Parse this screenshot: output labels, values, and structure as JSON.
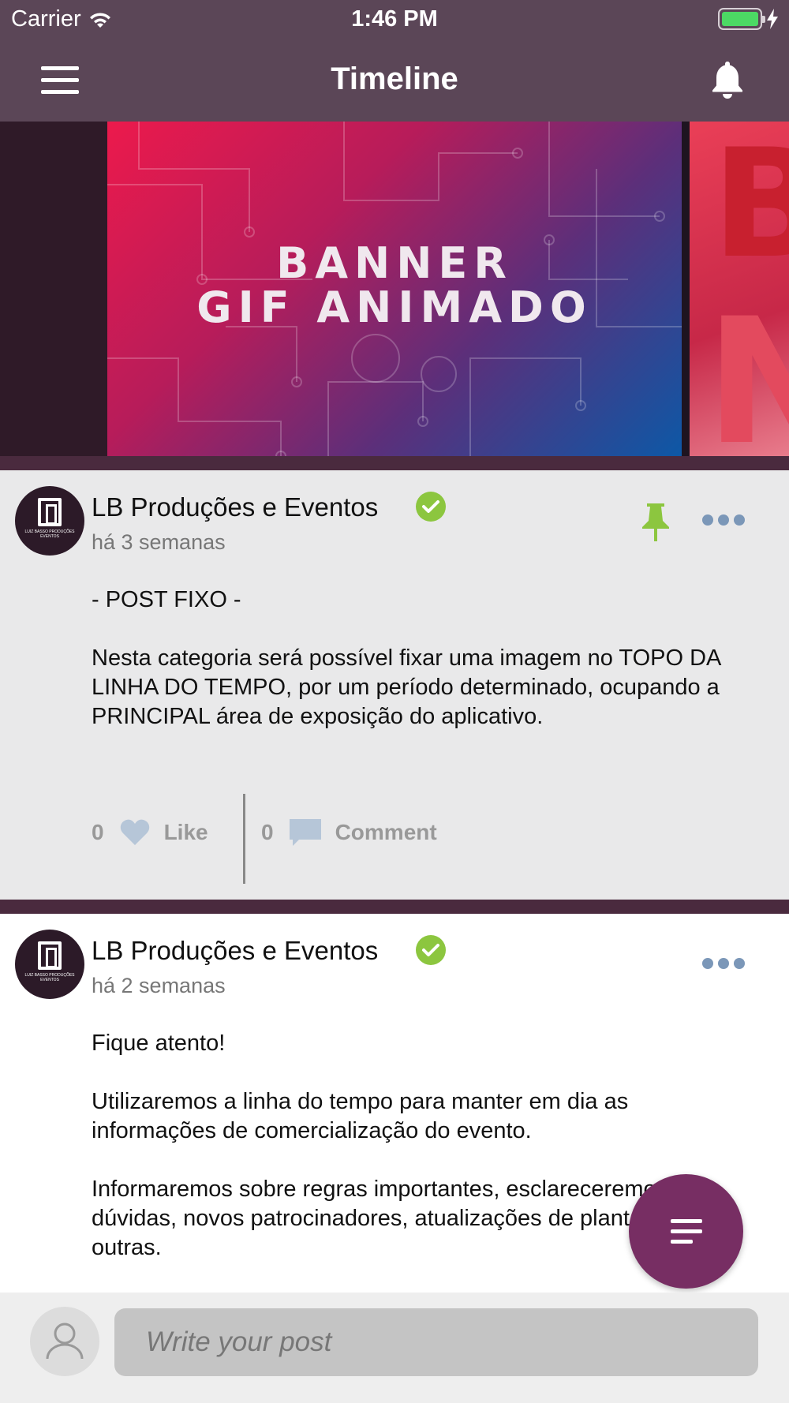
{
  "status_bar": {
    "carrier": "Carrier",
    "time": "1:46 PM"
  },
  "nav": {
    "title": "Timeline",
    "menu_icon": "hamburger-menu-icon",
    "notifications_icon": "bell-icon"
  },
  "banner": {
    "line1": "BANNER",
    "line2": "GIF ANIMADO",
    "next_slide_letters": "BN"
  },
  "colors": {
    "nav_bg": "#5b4657",
    "accent": "#772e63",
    "verified": "#8cc63f",
    "pin": "#8cc63f",
    "more": "#7b97b8"
  },
  "posts": [
    {
      "author": "LB Produções e Eventos",
      "time": "há 3 semanas",
      "pinned": true,
      "paragraphs": [
        "- POST FIXO -",
        "Nesta categoria será possível fixar uma imagem no TOPO DA LINHA DO TEMPO, por um período determinado, ocupando a PRINCIPAL área de exposição do aplicativo."
      ],
      "likes": "0",
      "like_label": "Like",
      "comments": "0",
      "comment_label": "Comment"
    },
    {
      "author": "LB Produções e Eventos",
      "time": "há 2 semanas",
      "pinned": false,
      "paragraphs": [
        "Fique atento!",
        "Utilizaremos a linha do tempo para manter em dia as informações de comercialização do evento.",
        "Informaremos sobre regras importantes, esclareceremos dúvidas, novos patrocinadores, atualizações de planta entre outras."
      ]
    }
  ],
  "avatar_logo_text": "LUIZ BASSO PRODUÇÕES EVENTOS",
  "composer": {
    "placeholder": "Write your post"
  }
}
